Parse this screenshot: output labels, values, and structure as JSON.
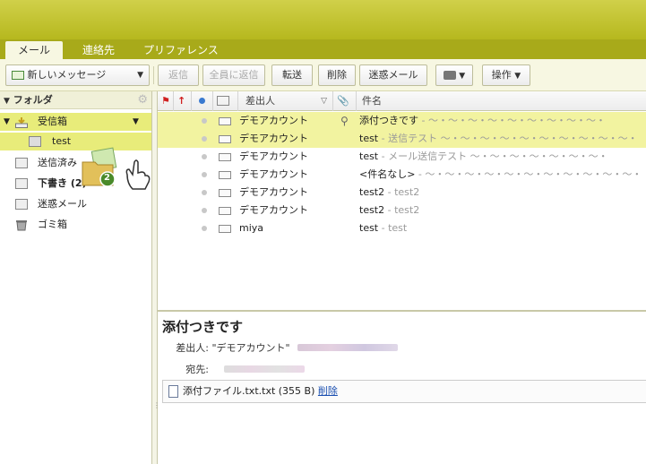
{
  "tabs": [
    {
      "label": "メール",
      "active": true
    },
    {
      "label": "連絡先",
      "active": false
    },
    {
      "label": "プリファレンス",
      "active": false
    }
  ],
  "toolbar": {
    "new_message": "新しいメッセージ",
    "reply": "返信",
    "reply_all": "全員に返信",
    "forward": "転送",
    "delete": "削除",
    "spam": "迷惑メール",
    "actions": "操作"
  },
  "folders": {
    "header": "フォルダ",
    "items": [
      {
        "label": "受信箱",
        "selected": true
      },
      {
        "label": "test",
        "selected": true
      },
      {
        "label": "送信済み"
      },
      {
        "label": "下書き (2)"
      },
      {
        "label": "迷惑メール"
      },
      {
        "label": "ゴミ箱"
      }
    ],
    "drag_badge": "2"
  },
  "list": {
    "col_from": "差出人",
    "col_subject": "件名",
    "rows": [
      {
        "from": "デモアカウント",
        "subject": "添付つきです",
        "preview": " - ～・～・～・～・～・～・～・～・～・",
        "attachment": true,
        "selected": true
      },
      {
        "from": "デモアカウント",
        "subject": "test",
        "preview": " - 送信テスト ～・～・～・～・～・～・～・～・～・～・",
        "attachment": false,
        "selected": true
      },
      {
        "from": "デモアカウント",
        "subject": "test",
        "preview": " - メール送信テスト ～・～・～・～・～・～・～・",
        "attachment": false,
        "selected": false
      },
      {
        "from": "デモアカウント",
        "subject": "<件名なし>",
        "preview": " - ～・～・～・～・～・～・～・～・～・～・～・",
        "attachment": false,
        "selected": false
      },
      {
        "from": "デモアカウント",
        "subject": "test2",
        "preview": " - test2",
        "attachment": false,
        "selected": false
      },
      {
        "from": "デモアカウント",
        "subject": "test2",
        "preview": " - test2",
        "attachment": false,
        "selected": false
      },
      {
        "from": "miya",
        "subject": "test",
        "preview": " - test",
        "attachment": false,
        "selected": false
      }
    ]
  },
  "reading": {
    "title": "添付つきです",
    "from_label": "差出人:",
    "from_value": "\"デモアカウント\"",
    "to_label": "宛先:",
    "attachment_name": "添付ファイル.txt.txt",
    "attachment_size": "(355 B)",
    "attachment_delete": "削除"
  },
  "colors": {
    "accent": "#b6b81e",
    "selected_row": "#f2f3a0",
    "selected_folder": "#e8ec7a"
  }
}
